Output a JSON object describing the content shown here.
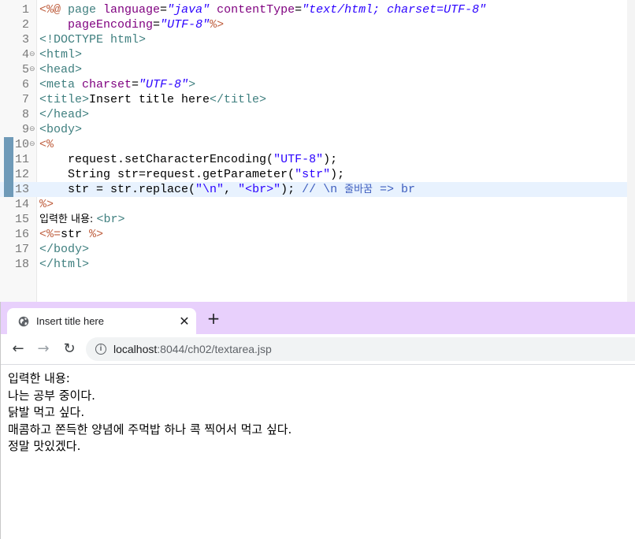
{
  "editor": {
    "lines": [
      {
        "num": "1",
        "fold": "",
        "mark": false,
        "current": false,
        "tokens": [
          {
            "c": "t-scr",
            "t": "<%@ "
          },
          {
            "c": "t-tag",
            "t": "page "
          },
          {
            "c": "t-attr",
            "t": "language"
          },
          {
            "c": "t-plain",
            "t": "="
          },
          {
            "c": "t-str",
            "t": "\"java\""
          },
          {
            "c": "t-plain",
            "t": " "
          },
          {
            "c": "t-attr",
            "t": "contentType"
          },
          {
            "c": "t-plain",
            "t": "="
          },
          {
            "c": "t-str",
            "t": "\"text/html; charset=UTF-8\""
          }
        ]
      },
      {
        "num": "2",
        "fold": "",
        "mark": false,
        "current": false,
        "tokens": [
          {
            "c": "t-plain",
            "t": "    "
          },
          {
            "c": "t-attr",
            "t": "pageEncoding"
          },
          {
            "c": "t-plain",
            "t": "="
          },
          {
            "c": "t-str",
            "t": "\"UTF-8\""
          },
          {
            "c": "t-scr",
            "t": "%>"
          }
        ]
      },
      {
        "num": "3",
        "fold": "",
        "mark": false,
        "current": false,
        "tokens": [
          {
            "c": "t-tag",
            "t": "<!DOCTYPE html>"
          }
        ]
      },
      {
        "num": "4",
        "fold": "⊖",
        "mark": false,
        "current": false,
        "tokens": [
          {
            "c": "t-tag",
            "t": "<html>"
          }
        ]
      },
      {
        "num": "5",
        "fold": "⊖",
        "mark": false,
        "current": false,
        "tokens": [
          {
            "c": "t-tag",
            "t": "<head>"
          }
        ]
      },
      {
        "num": "6",
        "fold": "",
        "mark": false,
        "current": false,
        "tokens": [
          {
            "c": "t-tag",
            "t": "<meta "
          },
          {
            "c": "t-attr",
            "t": "charset"
          },
          {
            "c": "t-plain",
            "t": "="
          },
          {
            "c": "t-str",
            "t": "\"UTF-8\""
          },
          {
            "c": "t-tag",
            "t": ">"
          }
        ]
      },
      {
        "num": "7",
        "fold": "",
        "mark": false,
        "current": false,
        "tokens": [
          {
            "c": "t-tag",
            "t": "<title>"
          },
          {
            "c": "t-plain",
            "t": "Insert title here"
          },
          {
            "c": "t-tag",
            "t": "</title>"
          }
        ]
      },
      {
        "num": "8",
        "fold": "",
        "mark": false,
        "current": false,
        "tokens": [
          {
            "c": "t-tag",
            "t": "</head>"
          }
        ]
      },
      {
        "num": "9",
        "fold": "⊖",
        "mark": false,
        "current": false,
        "tokens": [
          {
            "c": "t-tag",
            "t": "<body>"
          }
        ]
      },
      {
        "num": "10",
        "fold": "⊖",
        "mark": true,
        "current": false,
        "tokens": [
          {
            "c": "t-scr",
            "t": "<%"
          }
        ]
      },
      {
        "num": "11",
        "fold": "",
        "mark": true,
        "current": false,
        "tokens": [
          {
            "c": "t-plain",
            "t": "    request.setCharacterEncoding("
          },
          {
            "c": "t-jstr",
            "t": "\"UTF-8\""
          },
          {
            "c": "t-plain",
            "t": ");"
          }
        ]
      },
      {
        "num": "12",
        "fold": "",
        "mark": true,
        "current": false,
        "tokens": [
          {
            "c": "t-plain",
            "t": "    String str=request.getParameter("
          },
          {
            "c": "t-jstr",
            "t": "\"str\""
          },
          {
            "c": "t-plain",
            "t": ");"
          }
        ]
      },
      {
        "num": "13",
        "fold": "",
        "mark": true,
        "current": true,
        "tokens": [
          {
            "c": "t-plain",
            "t": "    str = str.replace("
          },
          {
            "c": "t-jstr",
            "t": "\"\\n\""
          },
          {
            "c": "t-plain",
            "t": ", "
          },
          {
            "c": "t-jstr",
            "t": "\"<br>\""
          },
          {
            "c": "t-plain",
            "t": "); "
          },
          {
            "c": "t-cmt",
            "t": "// \\n "
          },
          {
            "c": "t-cmt kr",
            "t": "줄바꿈"
          },
          {
            "c": "t-cmt",
            "t": " => br"
          }
        ]
      },
      {
        "num": "14",
        "fold": "",
        "mark": false,
        "current": false,
        "tokens": [
          {
            "c": "t-scr",
            "t": "%>"
          }
        ]
      },
      {
        "num": "15",
        "fold": "",
        "mark": false,
        "current": false,
        "tokens": [
          {
            "c": "t-plain kr",
            "t": "입력한 내용: "
          },
          {
            "c": "t-tag",
            "t": "<br>"
          }
        ]
      },
      {
        "num": "16",
        "fold": "",
        "mark": false,
        "current": false,
        "tokens": [
          {
            "c": "t-scr",
            "t": "<%="
          },
          {
            "c": "t-plain",
            "t": "str "
          },
          {
            "c": "t-scr",
            "t": "%>"
          }
        ]
      },
      {
        "num": "17",
        "fold": "",
        "mark": false,
        "current": false,
        "tokens": [
          {
            "c": "t-tag",
            "t": "</body>"
          }
        ]
      },
      {
        "num": "18",
        "fold": "",
        "mark": false,
        "current": false,
        "tokens": [
          {
            "c": "t-tag",
            "t": "</html>"
          }
        ]
      }
    ]
  },
  "browser": {
    "tab_title": "Insert title here",
    "tab_icon": "globe-icon",
    "close_glyph": "✕",
    "newtab_glyph": "+",
    "back_glyph": "←",
    "forward_glyph": "→",
    "reload_glyph": "↻",
    "info_glyph": "i",
    "url_host": "localhost",
    "url_rest": ":8044/ch02/textarea.jsp",
    "accent_color": "#e8d0fc"
  },
  "page": {
    "lines": [
      "입력한 내용:",
      "나는 공부 중이다.",
      "닭발 먹고 싶다.",
      "매콤하고 쫀득한 양념에 주먹밥 하나 콕 찍어서 먹고 싶다.",
      "정말 맛있겠다."
    ]
  }
}
